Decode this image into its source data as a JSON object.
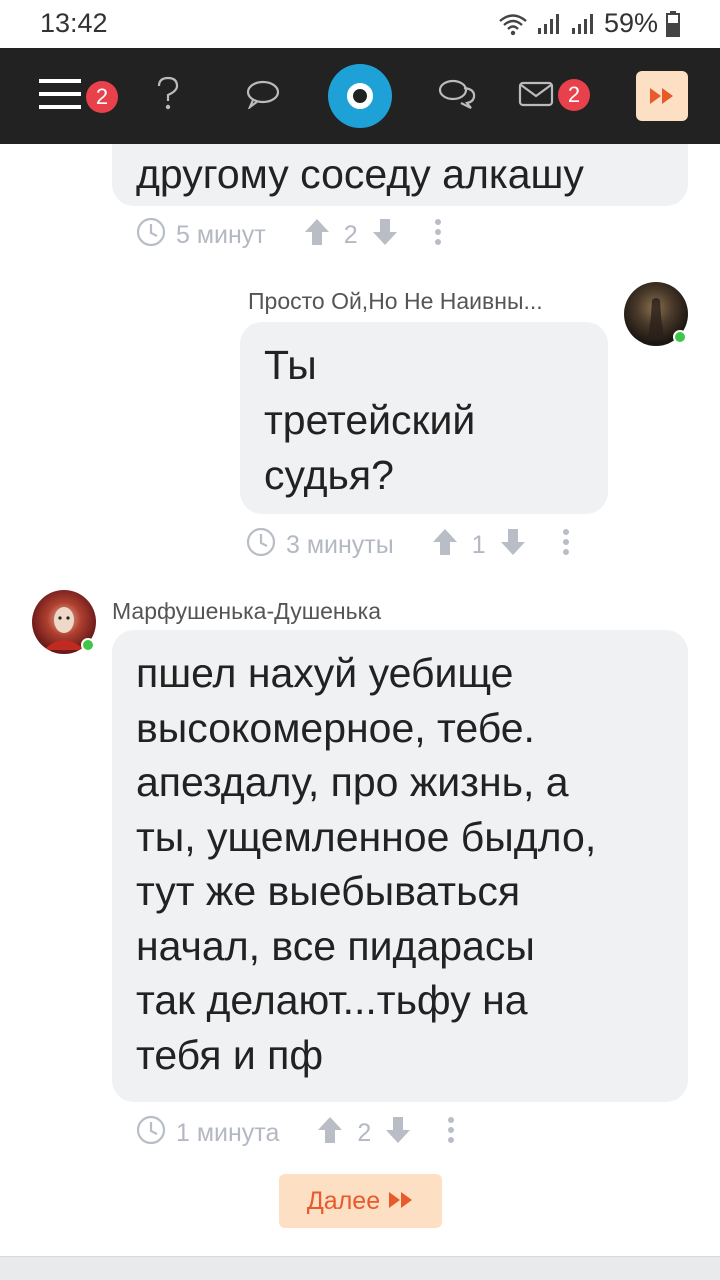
{
  "status_bar": {
    "time": "13:42",
    "battery": "59%",
    "icons": [
      "wifi-icon",
      "signal-icon",
      "signal-icon",
      "battery-icon"
    ]
  },
  "nav": {
    "menu_badge": "2",
    "messages_badge": "2",
    "icons": [
      "menu-icon",
      "question-icon",
      "chat-icon",
      "logo",
      "chats-icon",
      "mail-icon",
      "forward-icon"
    ],
    "accent_color": "#1ea1d7",
    "badge_color": "#e8414b"
  },
  "comments": [
    {
      "text": "другому соседу алкашу",
      "time": "5 минут",
      "score": "2"
    },
    {
      "author": "Просто Ой,Но Не Наивны...",
      "text": "Ты\nтретейский\nсудья?",
      "time": "3 минуты",
      "score": "1"
    },
    {
      "author": "Марфушенька-Душенька",
      "text": "пшел нахуй уебище\nвысокомерное, тебе.\nапездалу, про жизнь, а\nты, ущемленное быдло,\nтут же выебываться\nначал, все пидарасы\nтак делают...тьфу на\nтебя и пф",
      "time": "1 минута",
      "score": "2"
    }
  ],
  "next_button": {
    "label": "Далее"
  }
}
